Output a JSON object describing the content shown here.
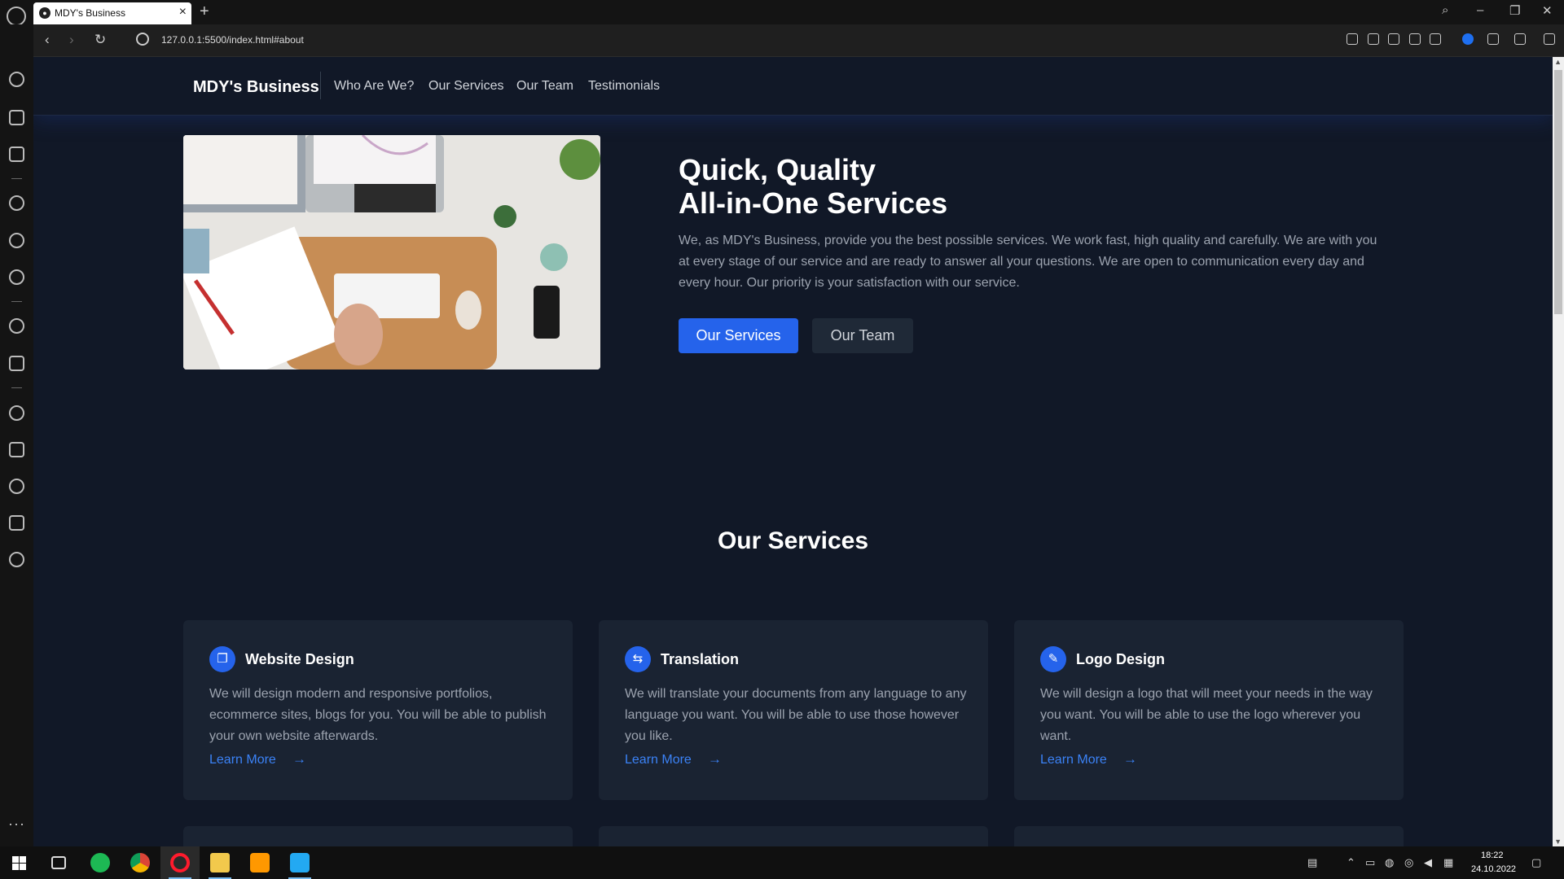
{
  "browser": {
    "tab_title": "MDY's Business",
    "url": "127.0.0.1:5500/index.html#about"
  },
  "site": {
    "brand": "MDY's Business",
    "nav": [
      "Who Are We?",
      "Our Services",
      "Our Team",
      "Testimonials"
    ]
  },
  "hero": {
    "title_line1": "Quick, Quality",
    "title_line2": "All-in-One Services",
    "text": "We, as MDY's Business, provide you the best possible services. We work fast, high quality and carefully. We are with you at every stage of our service and are ready to answer all your questions. We are open to communication every day and every hour. Our priority is your satisfaction with our service.",
    "btn_primary": "Our Services",
    "btn_secondary": "Our Team"
  },
  "services": {
    "title": "Our Services",
    "cards": [
      {
        "title": "Website Design",
        "text": "We will design modern and responsive portfolios, ecommerce sites, blogs for you. You will be able to publish your own website afterwards.",
        "link": "Learn More",
        "icon": "window-icon"
      },
      {
        "title": "Translation",
        "text": "We will translate your documents from any language to any language you want. You will be able to use those however you like.",
        "link": "Learn More",
        "icon": "translate-icon"
      },
      {
        "title": "Logo Design",
        "text": "We will design a logo that will meet your needs in the way you want. You will be able to use the logo wherever you want.",
        "link": "Learn More",
        "icon": "pencil-icon"
      }
    ]
  },
  "taskbar": {
    "time": "18:22",
    "date": "24.10.2022"
  },
  "colors": {
    "page_bg": "#111827",
    "card_bg": "#1a2332",
    "accent": "#2563eb",
    "link": "#3b82f6"
  }
}
